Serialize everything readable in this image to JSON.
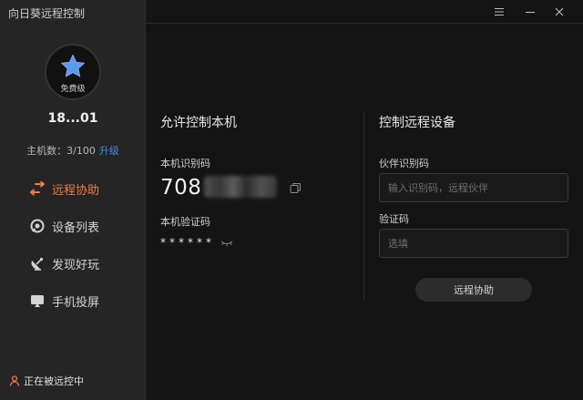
{
  "app": {
    "title": "向日葵远程控制"
  },
  "profile": {
    "tier": "免费级",
    "user_id": "18...01",
    "host_count_label": "主机数：3/100",
    "upgrade_label": "升级"
  },
  "sidebar": {
    "items": [
      {
        "label": "远程协助",
        "icon": "swap-arrows-icon",
        "active": true
      },
      {
        "label": "设备列表",
        "icon": "device-list-icon",
        "active": false
      },
      {
        "label": "发现好玩",
        "icon": "satellite-dish-icon",
        "active": false
      },
      {
        "label": "手机投屏",
        "icon": "screen-cast-icon",
        "active": false
      }
    ],
    "status": "正在被远控中"
  },
  "allow_control": {
    "title": "允许控制本机",
    "id_label": "本机识别码",
    "id_value": "708",
    "code_label": "本机验证码",
    "code_value": "******"
  },
  "remote_control": {
    "title": "控制远程设备",
    "partner_label": "伙伴识别码",
    "partner_placeholder": "输入识别码，远程伙伴",
    "code_label": "验证码",
    "code_placeholder": "选填",
    "button_label": "远程协助"
  },
  "colors": {
    "accent": "#ef7a49",
    "link": "#3d8fe6",
    "star": "#5b9bf0"
  }
}
